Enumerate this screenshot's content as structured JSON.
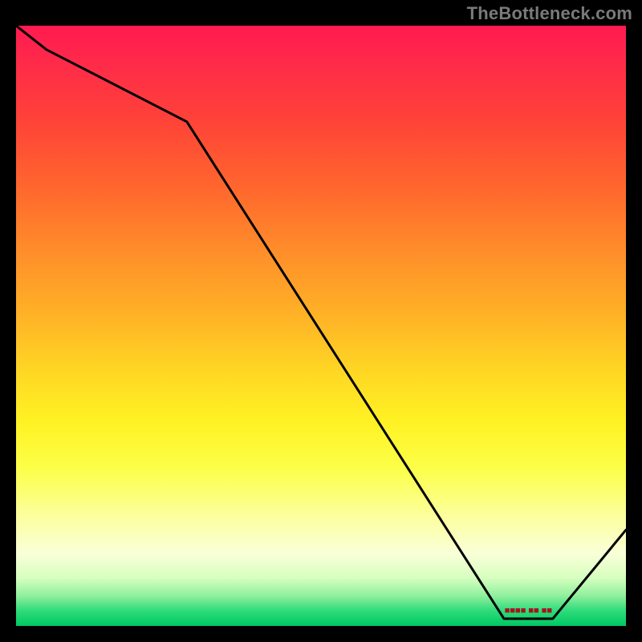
{
  "watermark": "TheBottleneck.com",
  "chart_data": {
    "type": "line",
    "title": "",
    "xlabel": "",
    "ylabel": "",
    "xlim": [
      0,
      100
    ],
    "ylim": [
      0,
      100
    ],
    "grid": false,
    "legend": false,
    "background_gradient": {
      "top": "#ff1a4f",
      "mid": "#fff223",
      "bottom": "#00c862"
    },
    "series": [
      {
        "name": "bottleneck-curve",
        "x": [
          0,
          5,
          28,
          80,
          88,
          100
        ],
        "values": [
          100,
          96,
          84,
          1.2,
          1.2,
          16
        ],
        "color": "#000000"
      }
    ],
    "annotations": [
      {
        "name": "optimal-marker",
        "text": "■■■■ ■■ ■■",
        "x": 84,
        "y": 2.5
      }
    ]
  }
}
